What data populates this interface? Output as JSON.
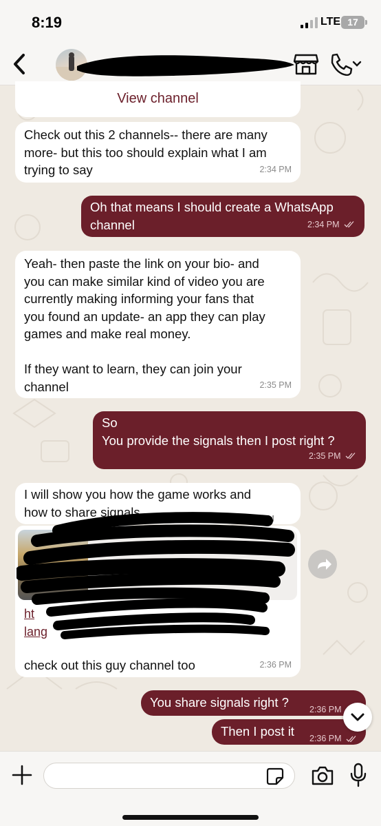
{
  "status_bar": {
    "time": "8:19",
    "network": "LTE",
    "battery": "17"
  },
  "header": {
    "back_icon": "chevron-left-icon",
    "avatar_icon": "contact-avatar",
    "store_icon": "storefront-icon",
    "call_icon": "phone-icon",
    "call_menu_icon": "chevron-down-icon"
  },
  "channel_preview": {
    "action_label": "View channel"
  },
  "messages": [
    {
      "direction": "incoming",
      "text": "Check out this 2 channels-- there are many\nmore- but this too should explain what I am\ntrying to say",
      "time": "2:34 PM"
    },
    {
      "direction": "outgoing",
      "text": "Oh that means I should create a WhatsApp\nchannel",
      "time": "2:34 PM",
      "status": "read"
    },
    {
      "direction": "incoming",
      "text": "Yeah- then paste the link on your bio- and\nyou can make similar kind of video you are\ncurrently making informing your fans that\nyou found an update- an app they can play\ngames and make real money.\n\nIf they want to learn, they can join your\nchannel",
      "time": "2:35 PM"
    },
    {
      "direction": "outgoing",
      "text": "So\nYou provide the signals then I post right ?",
      "time": "2:35 PM",
      "status": "read"
    },
    {
      "direction": "incoming",
      "text": "I will show you how the game works and\nhow to share signals",
      "time": "2:36 PM"
    },
    {
      "direction": "incoming",
      "text": "check out this guy channel too",
      "time": "2:36 PM",
      "link_text_visible": "ht\nlang"
    },
    {
      "direction": "outgoing",
      "text": "You share signals right ?",
      "time": "2:36 PM"
    },
    {
      "direction": "outgoing",
      "text": "Then I post it",
      "time": "2:36 PM",
      "status": "read"
    }
  ],
  "input_bar": {
    "placeholder": "",
    "plus_icon": "plus-icon",
    "sticker_icon": "sticker-icon",
    "camera_icon": "camera-icon",
    "mic_icon": "microphone-icon"
  },
  "colors": {
    "outgoing_bubble": "#6b1f2a",
    "incoming_bubble": "#ffffff",
    "chat_background": "#efeae2",
    "bar_background": "#f7f6f4"
  }
}
